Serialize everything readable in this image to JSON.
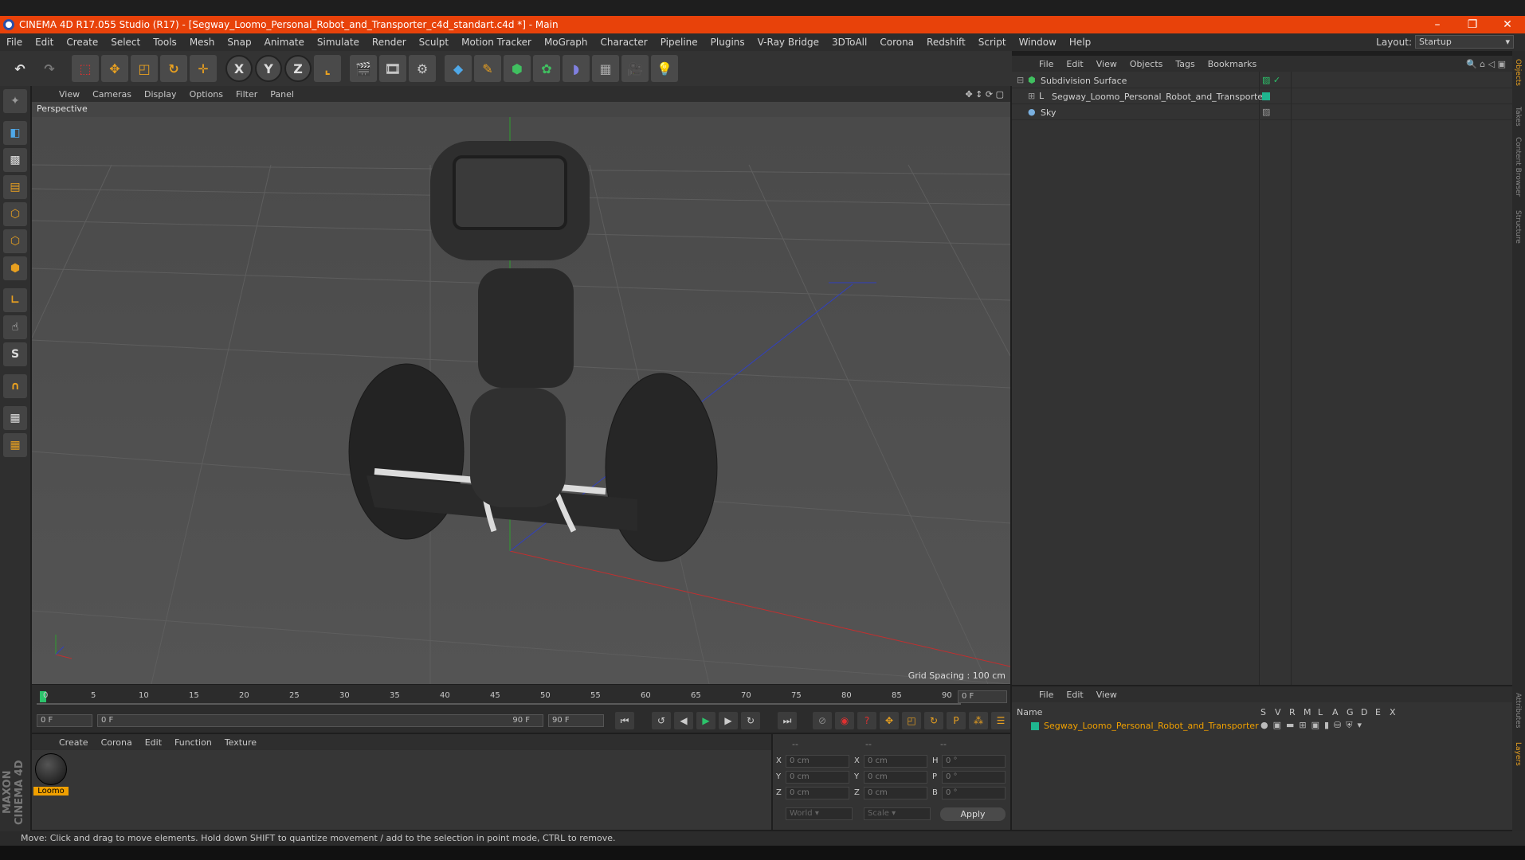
{
  "window": {
    "title": "CINEMA 4D R17.055 Studio (R17) - [Segway_Loomo_Personal_Robot_and_Transporter_c4d_standart.c4d *] - Main"
  },
  "menu": [
    "File",
    "Edit",
    "Create",
    "Select",
    "Tools",
    "Mesh",
    "Snap",
    "Animate",
    "Simulate",
    "Render",
    "Sculpt",
    "Motion Tracker",
    "MoGraph",
    "Character",
    "Pipeline",
    "Plugins",
    "V-Ray Bridge",
    "3DToAll",
    "Corona",
    "Redshift",
    "Script",
    "Window",
    "Help"
  ],
  "layout": {
    "label": "Layout:",
    "value": "Startup"
  },
  "toolbar": {
    "x_label": "X",
    "y_label": "Y",
    "z_label": "Z"
  },
  "viewport": {
    "menu": [
      "View",
      "Cameras",
      "Display",
      "Options",
      "Filter",
      "Panel"
    ],
    "label": "Perspective",
    "grid_spacing": "Grid Spacing : 100 cm"
  },
  "timeline": {
    "ticks": [
      "0",
      "5",
      "10",
      "15",
      "20",
      "25",
      "30",
      "35",
      "40",
      "45",
      "50",
      "55",
      "60",
      "65",
      "70",
      "75",
      "80",
      "85",
      "90"
    ],
    "current_frame": "0 F",
    "start_field": "0 F",
    "range_start": "0 F",
    "range_end": "90 F",
    "end_field": "90 F"
  },
  "materials": {
    "menu": [
      "Create",
      "Corona",
      "Edit",
      "Function",
      "Texture"
    ],
    "items": [
      {
        "name": "Loomo"
      }
    ]
  },
  "coords": {
    "col_headers": [
      "--",
      "--",
      "--"
    ],
    "rows": [
      {
        "a": "X",
        "av": "0 cm",
        "b": "X",
        "bv": "0 cm",
        "c": "H",
        "cv": "0 °"
      },
      {
        "a": "Y",
        "av": "0 cm",
        "b": "Y",
        "bv": "0 cm",
        "c": "P",
        "cv": "0 °"
      },
      {
        "a": "Z",
        "av": "0 cm",
        "b": "Z",
        "bv": "0 cm",
        "c": "B",
        "cv": "0 °"
      }
    ],
    "space": "World",
    "mode": "Scale",
    "apply": "Apply"
  },
  "object_manager": {
    "menu": [
      "File",
      "Edit",
      "View",
      "Objects",
      "Tags",
      "Bookmarks"
    ],
    "objects": [
      {
        "name": "Subdivision Surface"
      },
      {
        "name": "Segway_Loomo_Personal_Robot_and_Transporter"
      },
      {
        "name": "Sky"
      }
    ]
  },
  "layers": {
    "menu": [
      "File",
      "Edit",
      "View"
    ],
    "header_name": "Name",
    "flags": [
      "S",
      "V",
      "R",
      "M",
      "L",
      "A",
      "G",
      "D",
      "E",
      "X"
    ],
    "item": "Segway_Loomo_Personal_Robot_and_Transporter"
  },
  "side_tabs": [
    "Objects",
    "Takes",
    "Content Browser",
    "Structure",
    "Attributes",
    "Layers"
  ],
  "status": "Move: Click and drag to move elements. Hold down SHIFT to quantize movement / add to the selection in point mode, CTRL to remove.",
  "brand": "MAXON CINEMA 4D",
  "colors": {
    "accent": "#e8420a",
    "layer_green": "#1fb58f",
    "highlight": "#f0a000",
    "axis_x": "#c03030",
    "axis_y": "#2e9e2e",
    "axis_z": "#3040c0"
  }
}
